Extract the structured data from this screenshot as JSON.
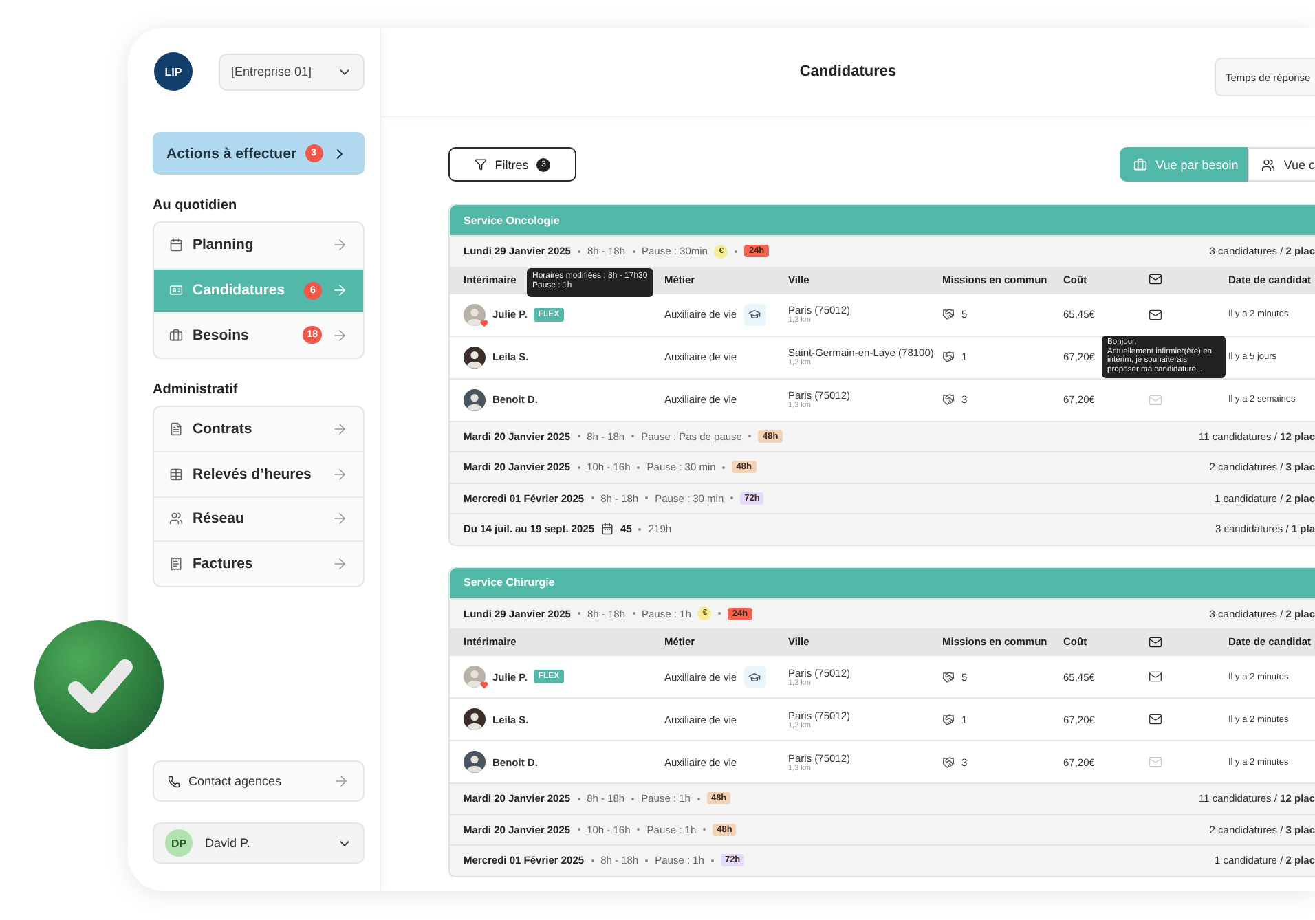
{
  "sidebar": {
    "logo": "LIP",
    "company": "[Entreprise 01]",
    "actions": {
      "label": "Actions à effectuer",
      "count": "3"
    },
    "sections": [
      {
        "title": "Au quotidien",
        "items": [
          {
            "label": "Planning",
            "selected": false
          },
          {
            "label": "Candidatures",
            "selected": true,
            "count": "6"
          },
          {
            "label": "Besoins",
            "selected": false,
            "count": "18"
          }
        ]
      },
      {
        "title": "Administratif",
        "items": [
          {
            "label": "Contrats",
            "selected": false
          },
          {
            "label": "Relevés d’heures",
            "selected": false
          },
          {
            "label": "Réseau",
            "selected": false
          },
          {
            "label": "Factures",
            "selected": false
          }
        ]
      }
    ],
    "contact": "Contact agences",
    "user": {
      "initials": "DP",
      "name": "David P."
    }
  },
  "header": {
    "title": "Candidatures",
    "response_button": "Temps de réponse"
  },
  "toolbar": {
    "filter": {
      "label": "Filtres",
      "count": "3"
    },
    "views": [
      {
        "label": "Vue par besoin",
        "selected": true
      },
      {
        "label": "Vue c",
        "selected": false
      }
    ]
  },
  "services": [
    {
      "title": "Service Oncologie",
      "columns": [
        "Intérimaire",
        "Métier",
        "Ville",
        "Missions en commun",
        "Coût",
        "Date de candidat"
      ],
      "days": [
        {
          "kind": "detail",
          "date": "Lundi 29 Janvier 2025",
          "hours": "8h - 18h",
          "pause": "Pause : 30min",
          "bonus": "€",
          "delay": {
            "label": "24h",
            "color": "#f26450"
          },
          "count": "3 candidatures / **2 plac**",
          "rows": [
            {
              "name": "Julie P.",
              "favorite": true,
              "badge": "FLEX",
              "job": "Auxiliaire de vie",
              "certified": true,
              "city": "Paris (75012)",
              "distance": "1,3 km",
              "missions": "5",
              "cost": "65,45€",
              "mail_active": true,
              "date": "Il y a 2 minutes",
              "tooltip": [
                "Horaires modifiées : 8h - 17h30",
                "Pause : 1h"
              ]
            },
            {
              "name": "Leila S.",
              "favorite": false,
              "job": "Auxiliaire de vie",
              "certified": false,
              "city": "Saint-Germain-en-Laye (78100)",
              "distance": "1,3 km",
              "missions": "1",
              "cost": "67,20€",
              "date": "Il y a 5 jours",
              "message": "Bonjour,\nActuellement infirmier(ère) en intérim, je souhaiterais proposer ma candidature..."
            },
            {
              "name": "Benoit D.",
              "favorite": false,
              "job": "Auxiliaire de vie",
              "certified": false,
              "city": "Paris (75012)",
              "distance": "1,3 km",
              "missions": "3",
              "cost": "67,20€",
              "mail_active": false,
              "date": "Il y a 2 semaines"
            }
          ]
        },
        {
          "kind": "detail",
          "date": "Mardi 20 Janvier 2025",
          "hours": "8h - 18h",
          "pause": "Pause : Pas de pause",
          "delay": {
            "label": "48h",
            "color": "#f3d2b8"
          },
          "count": "11 candidatures / **12 plac**"
        },
        {
          "kind": "detail",
          "date": "Mardi 20 Janvier 2025",
          "hours": "10h - 16h",
          "pause": "Pause : 30 min",
          "delay": {
            "label": "48h",
            "color": "#f3d2b8"
          },
          "count": "2 candidatures / **3 plac**"
        },
        {
          "kind": "detail",
          "date": "Mercredi 01 Février 2025",
          "hours": "8h - 18h",
          "pause": "Pause : 30 min",
          "delay": {
            "label": "72h",
            "color": "#e6dafa"
          },
          "count": "1 candidature / **2 plac**"
        },
        {
          "kind": "range",
          "date": "Du 14 juil. au 19 sept. 2025",
          "slots": "45",
          "hours": "219h",
          "count": "3 candidatures / **1 pla**"
        }
      ]
    },
    {
      "title": "Service Chirurgie",
      "columns": [
        "Intérimaire",
        "Métier",
        "Ville",
        "Missions en commun",
        "Coût",
        "Date de candidat"
      ],
      "days": [
        {
          "kind": "detail",
          "date": "Lundi 29 Janvier 2025",
          "hours": "8h - 18h",
          "pause": "Pause : 1h",
          "bonus": "€",
          "delay": {
            "label": "24h",
            "color": "#f26450"
          },
          "count": "3 candidatures / **2 plac**",
          "rows": [
            {
              "name": "Julie P.",
              "favorite": true,
              "badge": "FLEX",
              "job": "Auxiliaire de vie",
              "certified": true,
              "city": "Paris (75012)",
              "distance": "1,3 km",
              "missions": "5",
              "cost": "65,45€",
              "mail_active": true,
              "date": "Il y a 2 minutes"
            },
            {
              "name": "Leila S.",
              "favorite": false,
              "job": "Auxiliaire de vie",
              "certified": false,
              "city": "Paris (75012)",
              "distance": "1,3 km",
              "missions": "1",
              "cost": "67,20€",
              "mail_active": true,
              "date": "Il y a 2 minutes"
            },
            {
              "name": "Benoit D.",
              "favorite": false,
              "job": "Auxiliaire de vie",
              "certified": false,
              "city": "Paris (75012)",
              "distance": "1,3 km",
              "missions": "3",
              "cost": "67,20€",
              "mail_active": false,
              "date": "Il y a 2 minutes"
            }
          ]
        },
        {
          "kind": "detail",
          "date": "Mardi 20 Janvier 2025",
          "hours": "8h - 18h",
          "pause": "Pause : 1h",
          "delay": {
            "label": "48h",
            "color": "#f3d2b8"
          },
          "count": "11 candidatures / **12 plac**"
        },
        {
          "kind": "detail",
          "date": "Mardi 20 Janvier 2025",
          "hours": "10h - 16h",
          "pause": "Pause : 1h",
          "delay": {
            "label": "48h",
            "color": "#f3d2b8"
          },
          "count": "2 candidatures / **3 plac**"
        },
        {
          "kind": "detail",
          "date": "Mercredi 01 Février 2025",
          "hours": "8h - 18h",
          "pause": "Pause : 1h",
          "delay": {
            "label": "72h",
            "color": "#e6dafa"
          },
          "count": "1 candidature / **2 plac**"
        }
      ]
    }
  ]
}
